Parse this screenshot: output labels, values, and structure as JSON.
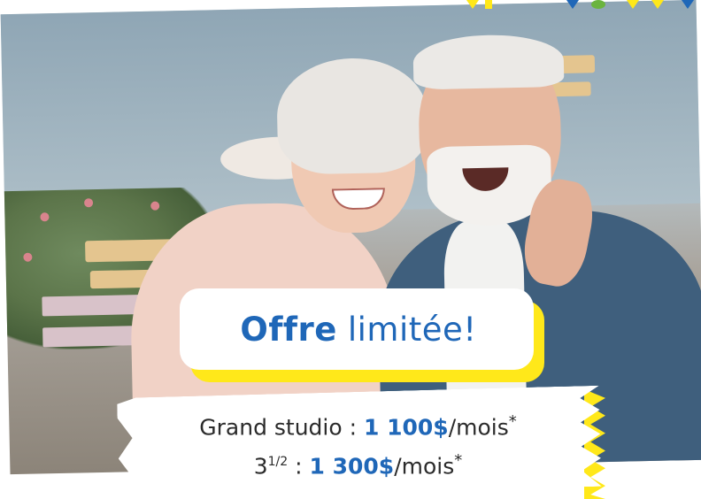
{
  "headline": {
    "bold": "Offre",
    "rest": "limitée!"
  },
  "prices": {
    "line1": {
      "label": "Grand studio :",
      "amount": "1 100$",
      "period": "/mois",
      "asterisk": "*"
    },
    "line2": {
      "label_base": "3",
      "label_sup": "1/2",
      "separator": ":",
      "amount": "1 300$",
      "period": "/mois",
      "asterisk": "*"
    }
  },
  "colors": {
    "brand_blue": "#1f67b8",
    "accent_yellow": "#ffe81a"
  }
}
